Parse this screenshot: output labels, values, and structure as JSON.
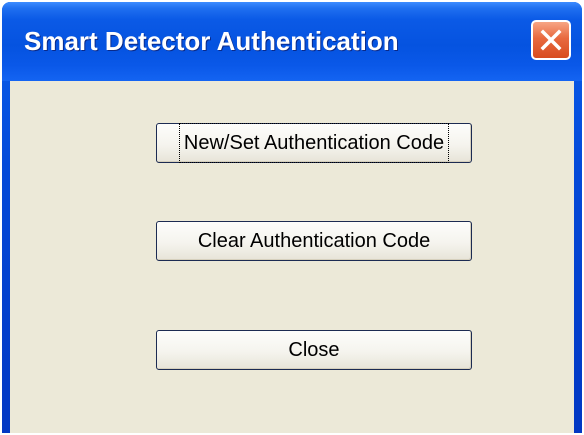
{
  "window": {
    "title": "Smart Detector Authentication"
  },
  "buttons": {
    "new_set": "New/Set Authentication Code",
    "clear": "Clear Authentication Code",
    "close": "Close"
  },
  "colors": {
    "titlebar": "#0553e0",
    "dialog_bg": "#ece9d8",
    "close_button": "#d84c1e"
  },
  "icons": {
    "close": "close-x-icon"
  }
}
